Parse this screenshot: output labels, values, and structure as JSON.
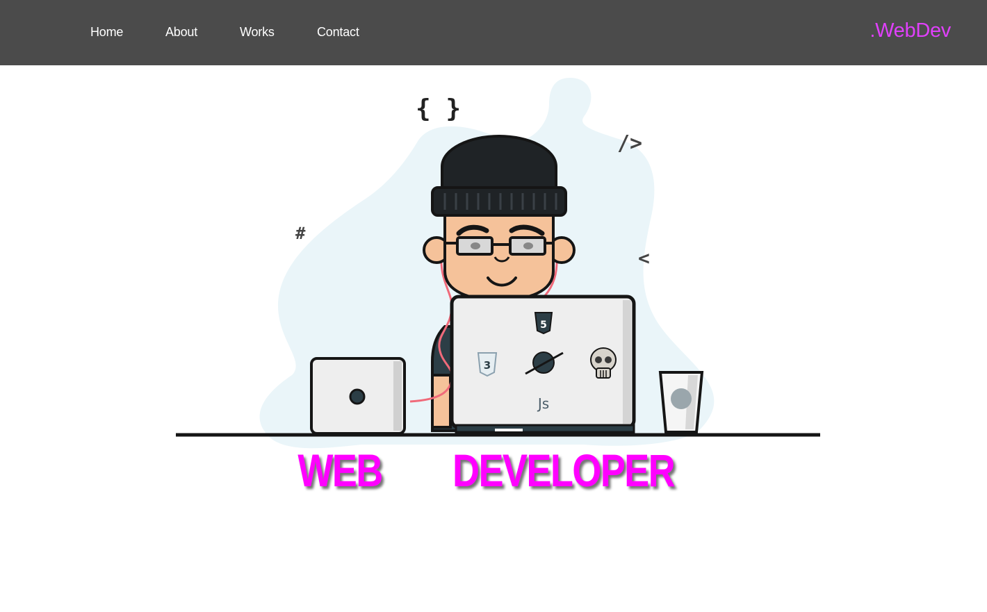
{
  "nav": {
    "items": [
      {
        "label": "Home"
      },
      {
        "label": "About"
      },
      {
        "label": "Works"
      },
      {
        "label": "Contact"
      }
    ],
    "brand": ".WebDev"
  },
  "hero": {
    "title_word_1": "WEB",
    "title_word_2": "DEVELOPER",
    "laptop_js_label": "Js",
    "laptop_html_badge": "5",
    "laptop_css_badge": "3",
    "symbol_braces": "{ }",
    "symbol_slash": "/>",
    "symbol_hash": "#",
    "symbol_lt": "<"
  },
  "colors": {
    "nav_bg": "#4b4b4b",
    "brand": "#e040fb",
    "title": "#ff00ff",
    "blob": "#eaf5f9"
  },
  "icons": [
    "html5-icon",
    "css3-icon",
    "planet-icon",
    "skull-icon"
  ]
}
